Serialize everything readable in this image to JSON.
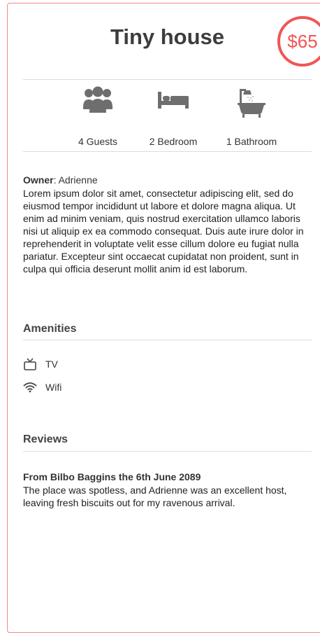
{
  "listing": {
    "title": "Tiny house",
    "price": "$65"
  },
  "stats": [
    {
      "label": "4 Guests",
      "icon": "guests-icon"
    },
    {
      "label": "2 Bedroom",
      "icon": "bed-icon"
    },
    {
      "label": "1 Bathroom",
      "icon": "bathtub-icon"
    }
  ],
  "owner": {
    "label": "Owner",
    "name": "Adrienne",
    "description": "Lorem ipsum dolor sit amet, consectetur adipiscing elit, sed do eiusmod tempor incididunt ut labore et dolore magna aliqua. Ut enim ad minim veniam, quis nostrud exercitation ullamco laboris nisi ut aliquip ex ea commodo consequat. Duis aute irure dolor in reprehenderit in voluptate velit esse cillum dolore eu fugiat nulla pariatur. Excepteur sint occaecat cupidatat non proident, sunt in culpa qui officia deserunt mollit anim id est laborum."
  },
  "amenities": {
    "heading": "Amenities",
    "items": [
      {
        "label": "TV",
        "icon": "tv-icon"
      },
      {
        "label": "Wifi",
        "icon": "wifi-icon"
      }
    ]
  },
  "reviews": {
    "heading": "Reviews",
    "items": [
      {
        "title": "From Bilbo Baggins the 6th June 2089",
        "text": "The place was spotless, and Adrienne was an excellent host, leaving fresh biscuits out for my ravenous arrival."
      }
    ]
  },
  "colors": {
    "accent": "#f15555",
    "card_border": "#f08a8a",
    "icon_gray": "#6e6e6e",
    "divider": "#dcdcdc"
  }
}
